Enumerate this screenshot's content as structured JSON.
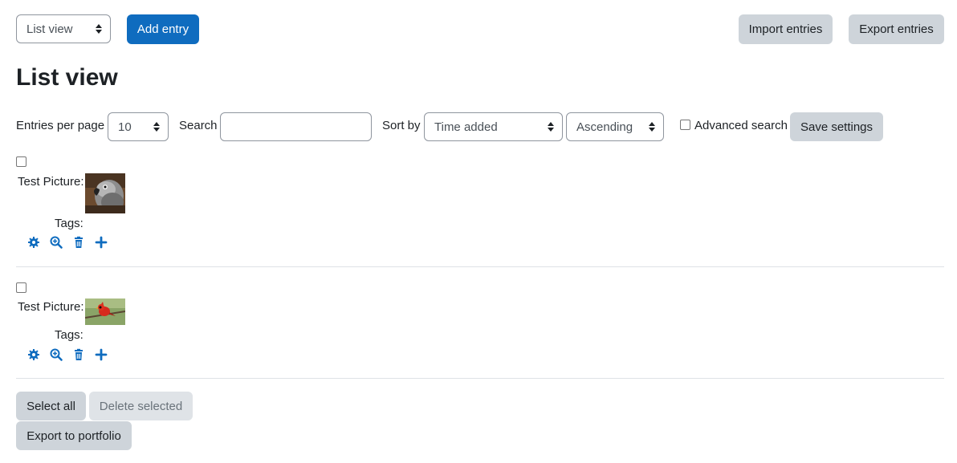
{
  "toolbar": {
    "view_select": "List view",
    "add_entry": "Add entry",
    "import_entries": "Import entries",
    "export_entries": "Export entries"
  },
  "page": {
    "title": "List view"
  },
  "filters": {
    "entries_per_page_label": "Entries per page",
    "entries_per_page_value": "10",
    "search_label": "Search",
    "search_value": "",
    "sort_by_label": "Sort by",
    "sort_field": "Time added",
    "sort_order": "Ascending",
    "advanced_search_label": "Advanced search",
    "save_settings": "Save settings"
  },
  "entries": [
    {
      "field_label": "Test Picture:",
      "tags_label": "Tags:",
      "image": "parrot"
    },
    {
      "field_label": "Test Picture:",
      "tags_label": "Tags:",
      "image": "red-bird"
    }
  ],
  "footer": {
    "select_all": "Select all",
    "delete_selected": "Delete selected",
    "export_to_portfolio": "Export to portfolio"
  },
  "colors": {
    "accent": "#0f6cbf",
    "secondary": "#ced4da"
  }
}
